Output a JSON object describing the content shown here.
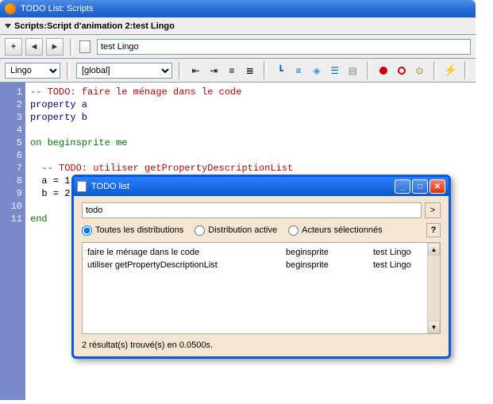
{
  "window": {
    "title": "TODO List: Scripts"
  },
  "breadcrumb": {
    "text": "Scripts:Script d'animation 2:test Lingo"
  },
  "toolbar1": {
    "add": "+",
    "back": "◄",
    "fwd": "►",
    "script_name": "test Lingo"
  },
  "toolbar2": {
    "language": "Lingo",
    "scope": "[global]"
  },
  "code": {
    "lines": [
      {
        "n": "1",
        "t": "-- TODO: faire le ménage dans le code",
        "cls": "c-comment"
      },
      {
        "n": "2",
        "t": "property a",
        "cls": "c-prop"
      },
      {
        "n": "3",
        "t": "property b",
        "cls": "c-prop"
      },
      {
        "n": "4",
        "t": "",
        "cls": ""
      },
      {
        "n": "5",
        "t": "on beginsprite me",
        "cls": "c-keyword"
      },
      {
        "n": "6",
        "t": "",
        "cls": ""
      },
      {
        "n": "7",
        "t": "  -- TODO: utiliser getPropertyDescriptionList",
        "cls": "c-comment"
      },
      {
        "n": "8",
        "t": "  a = 1",
        "cls": ""
      },
      {
        "n": "9",
        "t": "  b = 2",
        "cls": ""
      },
      {
        "n": "10",
        "t": "",
        "cls": ""
      },
      {
        "n": "11",
        "t": "end",
        "cls": "c-keyword"
      }
    ]
  },
  "dialog": {
    "title": "TODO list",
    "search_value": "todo",
    "go": ">",
    "radio_all": "Toutes les distributions",
    "radio_active": "Distribution active",
    "radio_selected": "Acteurs sélectionnés",
    "help": "?",
    "results": [
      {
        "desc": "faire le ménage dans le code",
        "handler": "beginsprite",
        "script": "test Lingo"
      },
      {
        "desc": "utiliser getPropertyDescriptionList",
        "handler": "beginsprite",
        "script": "test Lingo"
      }
    ],
    "status": "2 résultat(s) trouvé(s) en 0.0500s.",
    "min": "_",
    "max": "□",
    "close": "✕"
  }
}
